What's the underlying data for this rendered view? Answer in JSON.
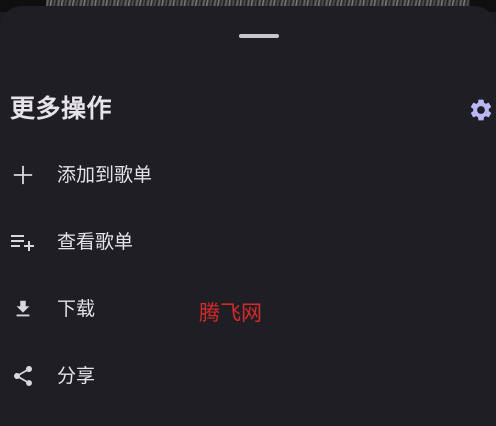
{
  "sheet": {
    "title": "更多操作",
    "settings_icon": "gear-icon",
    "accent_color": "#b9b7f7"
  },
  "menu": {
    "items": [
      {
        "label": "添加到歌单",
        "icon": "plus-icon"
      },
      {
        "label": "查看歌单",
        "icon": "playlist-add-icon"
      },
      {
        "label": "下载",
        "icon": "download-icon"
      },
      {
        "label": "分享",
        "icon": "share-icon"
      }
    ]
  },
  "watermark": {
    "text": "腾飞网",
    "color": "#d42a2a"
  }
}
